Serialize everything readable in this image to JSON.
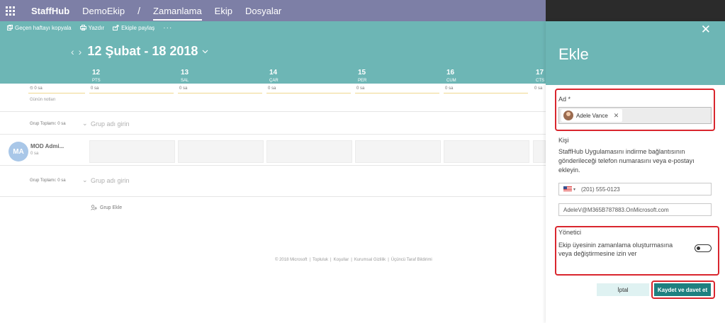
{
  "topnav": {
    "brand": "StaffHub",
    "team": "DemoEkip",
    "separator": "/",
    "tabs": [
      "Zamanlama",
      "Ekip",
      "Dosyalar"
    ]
  },
  "toolbar": {
    "copy_label": "Geçen haftayı kopyala",
    "print_label": "Yazdır",
    "share_label": "Ekiple paylaş",
    "more_label": "···"
  },
  "schedule": {
    "prev_icon": "‹",
    "next_icon": "›",
    "date_range": "12 Şubat - 18 2018",
    "days": [
      {
        "num": "12",
        "name": "PTS"
      },
      {
        "num": "13",
        "name": "SAL"
      },
      {
        "num": "14",
        "name": "ÇAR"
      },
      {
        "num": "15",
        "name": "PER"
      },
      {
        "num": "16",
        "name": "CUM"
      },
      {
        "num": "17",
        "name": "CTS"
      }
    ],
    "day_hours": "0 sa",
    "total_hours": "0 sa",
    "day_notes_label": "Günün notları",
    "groups": [
      {
        "total_label": "Grup Toplamı: 0 sa",
        "placeholder": "Grup adı girin"
      },
      {
        "total_label": "Grup Toplamı: 0 sa",
        "placeholder": "Grup adı girin"
      }
    ],
    "member": {
      "initials": "MA",
      "name": "MOD Admi...",
      "hours": "0 sa"
    },
    "add_group_label": "Grup Ekle",
    "footer": [
      "© 2018 Microsoft",
      "Topluluk",
      "Koşullar",
      "Kurumsal Gizlilik",
      "Üçüncü Taraf Bildirimi"
    ]
  },
  "panel": {
    "title": "Ekle",
    "close_icon": "✕",
    "name_label": "Ad *",
    "chip_name": "Adele Vance",
    "chip_remove": "✕",
    "person_label": "Kişi",
    "person_desc": "StaffHub Uygulamasını indirme bağlantısının gönderileceği telefon numarasını veya e-postayı ekleyin.",
    "phone_value": "(201) 555-0123",
    "email_value": "AdeleV@M365B787883.OnMicrosoft.com",
    "manager_label": "Yönetici",
    "manager_desc": "Ekip üyesinin zamanlama oluşturmasına veya değiştirmesine izin ver",
    "manager_enabled": false,
    "cancel_label": "İptal",
    "save_label": "Kaydet ve davet et"
  },
  "colors": {
    "nav_bg": "#7d7fa6",
    "accent": "#6db6b5",
    "primary_button": "#1e8080",
    "highlight": "#d9262e"
  }
}
